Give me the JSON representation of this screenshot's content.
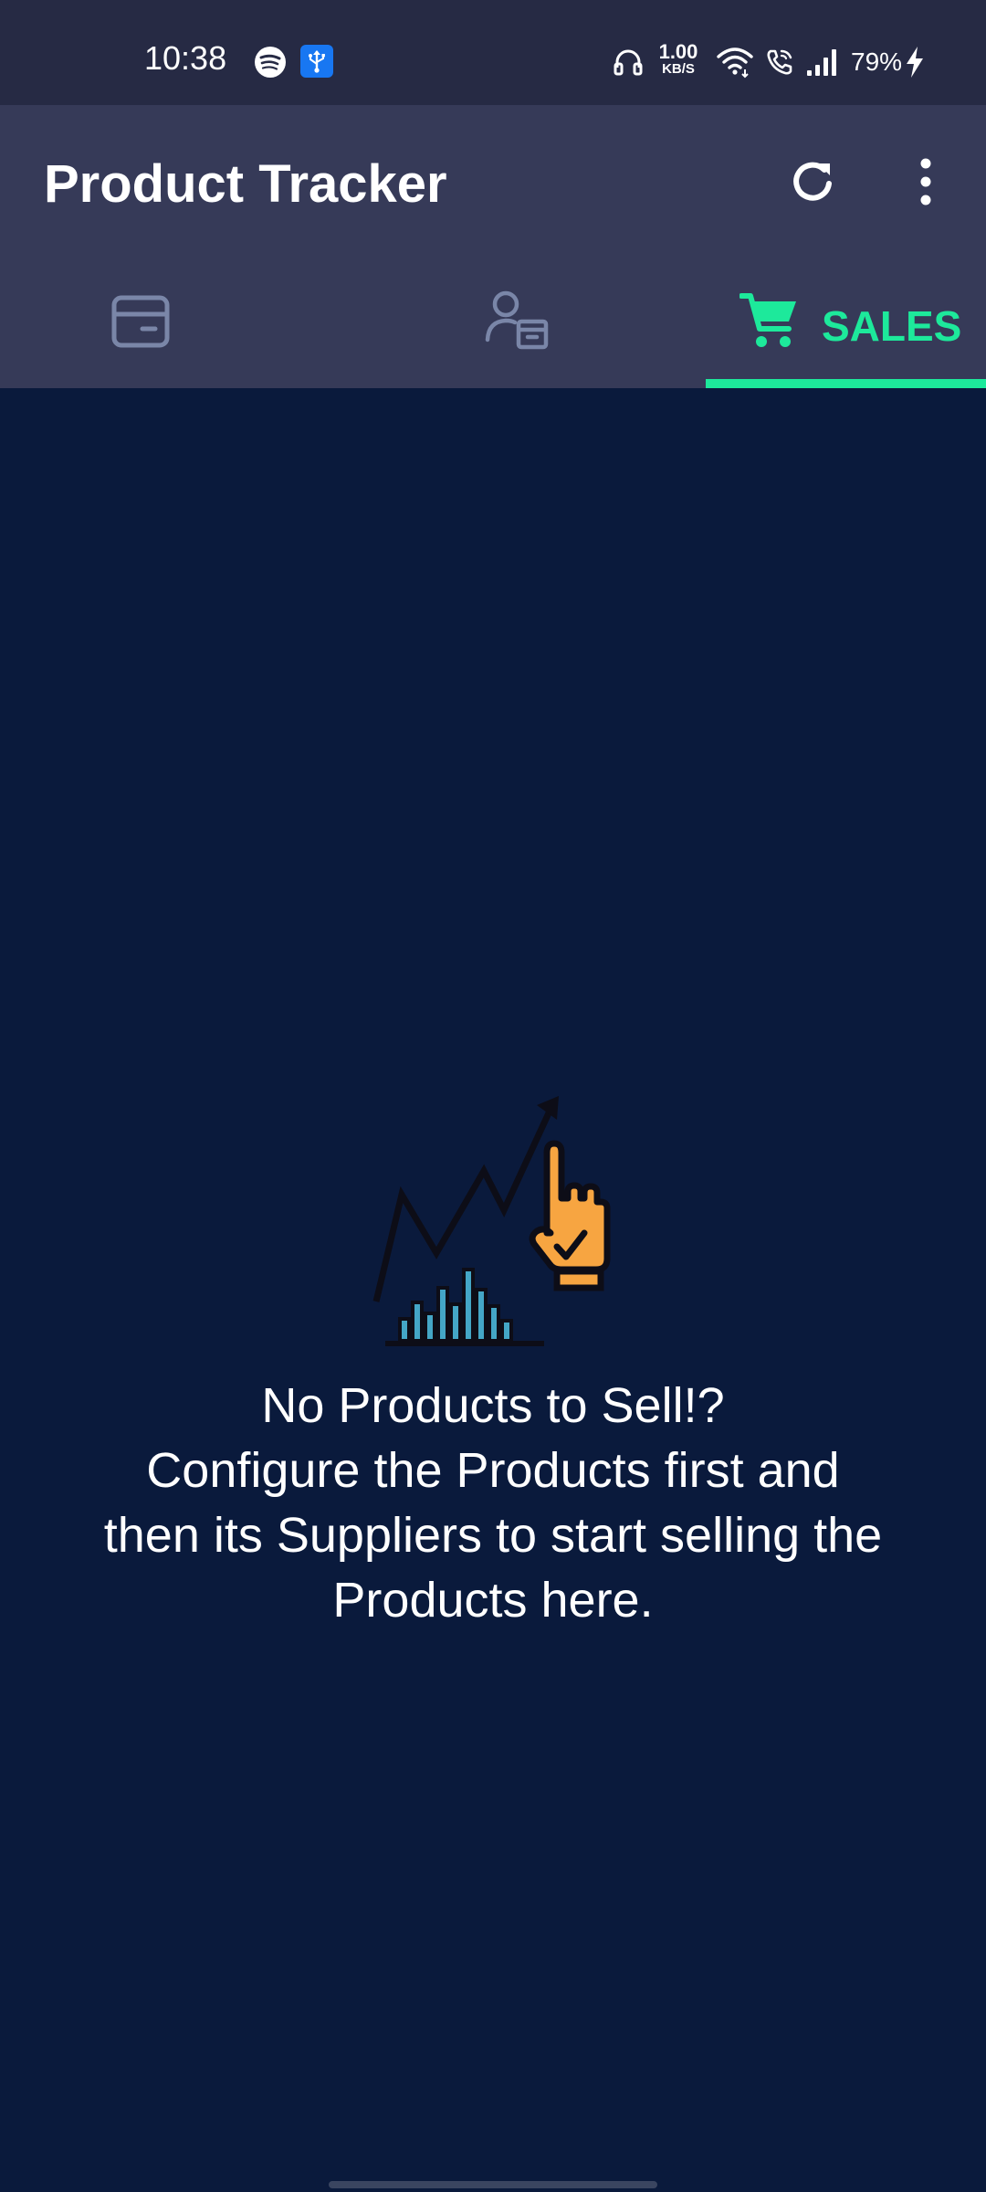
{
  "status_bar": {
    "time": "10:38",
    "net_speed_value": "1.00",
    "net_speed_unit": "KB/S",
    "battery": "79%",
    "icons": [
      "spotify-icon",
      "usb-debug-icon",
      "headset-icon",
      "wifi-icon",
      "wifi-call-icon",
      "signal-icon",
      "charging-bolt-icon"
    ],
    "usb_icon_color": "#1877f2"
  },
  "app_bar": {
    "title": "Product Tracker",
    "actions": [
      "refresh-icon",
      "more-vert-icon"
    ],
    "background": "#363a58"
  },
  "tabs": [
    {
      "id": "products",
      "icon": "archive-box-icon",
      "label": "",
      "selected": false
    },
    {
      "id": "suppliers",
      "icon": "supplier-person-box-icon",
      "label": "",
      "selected": false
    },
    {
      "id": "sales",
      "icon": "shopping-cart-icon",
      "label": "SALES",
      "selected": true
    }
  ],
  "colors": {
    "accent": "#1de99b",
    "background": "#0a1a3c",
    "inactive_tab_icon": "#7a86a8",
    "illustration_orange": "#f7a541",
    "illustration_blue": "#44a6c6"
  },
  "empty_state": {
    "illustration": "sales-chart-hand-illustration",
    "lines": [
      "No Products to Sell!?",
      "Configure the Products first and",
      "then its Suppliers to start selling the",
      "Products here."
    ]
  }
}
